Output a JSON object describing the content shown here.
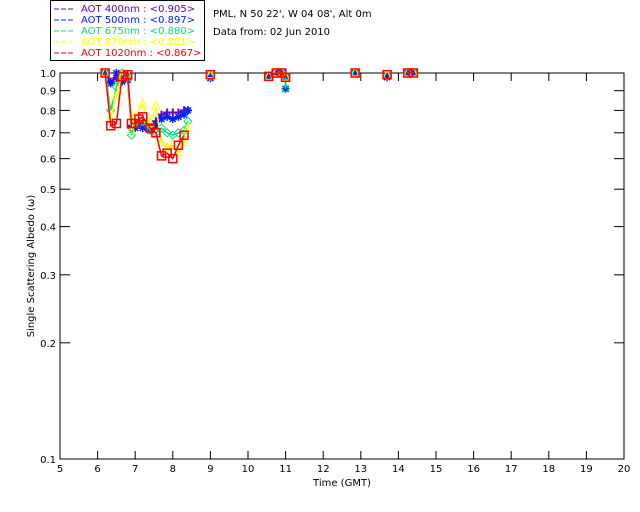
{
  "header": {
    "site_line": "PML, N 50 22', W 04 08', Alt 0m",
    "date_line": "Data from: 02 Jun 2010"
  },
  "chart_data": {
    "type": "scatter",
    "xlabel": "Time (GMT)",
    "ylabel": "Single Scattering Albedo (ω)",
    "xlim": [
      5,
      20
    ],
    "ylim": [
      0.1,
      1.0
    ],
    "yscale": "log",
    "xticks": [
      "5",
      "6",
      "7",
      "8",
      "9",
      "10",
      "11",
      "12",
      "13",
      "14",
      "15",
      "16",
      "17",
      "18",
      "19",
      "20"
    ],
    "yticks": [
      "0.1",
      "0.2",
      "0.3",
      "0.4",
      "0.5",
      "0.6",
      "0.7",
      "0.8",
      "0.9",
      "1.0"
    ],
    "grid": false,
    "legend_position": "top-left outside",
    "series": [
      {
        "name": "AOT  400nm : <0.905>",
        "color": "#6a00b0",
        "marker": "plus",
        "x": [
          6.2,
          6.35,
          6.5,
          6.65,
          6.8,
          6.9,
          7.0,
          7.2,
          7.4,
          7.55,
          7.7,
          7.85,
          8.0,
          8.15,
          8.3,
          8.4,
          9.0,
          10.55,
          10.75,
          10.9,
          11.0,
          12.85,
          13.7,
          14.25,
          14.4
        ],
        "y": [
          1.0,
          0.95,
          0.97,
          0.96,
          0.99,
          0.73,
          0.73,
          0.74,
          0.73,
          0.75,
          0.78,
          0.79,
          0.79,
          0.79,
          0.8,
          0.8,
          0.98,
          0.98,
          1.0,
          1.0,
          0.975,
          1.0,
          0.985,
          1.0,
          1.0
        ]
      },
      {
        "name": "AOT  500nm : <0.897>",
        "color": "#0020ff",
        "marker": "star",
        "x": [
          6.2,
          6.35,
          6.5,
          6.65,
          6.8,
          6.9,
          7.0,
          7.2,
          7.4,
          7.55,
          7.7,
          7.85,
          8.0,
          8.15,
          8.3,
          8.4,
          9.0,
          10.55,
          10.75,
          10.9,
          11.0,
          11.0,
          12.85,
          13.7,
          14.25,
          14.4
        ],
        "y": [
          1.0,
          0.94,
          1.0,
          0.95,
          0.96,
          0.72,
          0.72,
          0.72,
          0.71,
          0.73,
          0.76,
          0.77,
          0.76,
          0.77,
          0.78,
          0.8,
          0.97,
          0.98,
          1.0,
          1.0,
          0.975,
          0.91,
          1.0,
          0.975,
          1.0,
          1.0
        ]
      },
      {
        "name": "AOT  675nm : <0.880>",
        "color": "#00e080",
        "marker": "diamond",
        "x": [
          6.2,
          6.35,
          6.5,
          6.65,
          6.8,
          6.9,
          7.0,
          7.2,
          7.4,
          7.55,
          7.7,
          7.85,
          8.0,
          8.15,
          8.3,
          8.4,
          9.0,
          10.55,
          10.75,
          10.9,
          11.0,
          11.0,
          12.85,
          13.7,
          14.25,
          14.4
        ],
        "y": [
          1.0,
          0.8,
          0.92,
          1.0,
          0.97,
          0.69,
          0.74,
          0.75,
          0.71,
          0.7,
          0.72,
          0.7,
          0.69,
          0.7,
          0.71,
          0.75,
          0.98,
          0.98,
          1.0,
          1.0,
          0.975,
          0.91,
          1.0,
          0.985,
          1.0,
          1.0
        ]
      },
      {
        "name": "AOT  870nm : <0.881>",
        "color": "#ffff00",
        "marker": "triangle",
        "x": [
          6.2,
          6.35,
          6.5,
          6.65,
          6.8,
          6.9,
          7.0,
          7.2,
          7.4,
          7.55,
          7.7,
          7.85,
          8.0,
          8.15,
          8.3,
          8.4,
          9.0,
          10.55,
          10.75,
          10.9,
          11.0,
          12.85,
          13.7,
          14.25,
          14.4
        ],
        "y": [
          1.0,
          0.76,
          0.87,
          0.98,
          0.99,
          0.71,
          0.77,
          0.83,
          0.74,
          0.82,
          0.66,
          0.64,
          0.65,
          0.62,
          0.66,
          0.72,
          0.99,
          0.98,
          1.0,
          1.0,
          0.975,
          1.0,
          0.985,
          1.0,
          1.0
        ]
      },
      {
        "name": "AOT 1020nm : <0.867>",
        "color": "#ff0000",
        "marker": "square",
        "x": [
          6.2,
          6.35,
          6.5,
          6.65,
          6.8,
          6.9,
          7.0,
          7.1,
          7.2,
          7.4,
          7.55,
          7.7,
          7.85,
          8.0,
          8.15,
          8.3,
          9.0,
          10.55,
          10.75,
          10.9,
          11.0,
          12.85,
          13.7,
          14.25,
          14.4
        ],
        "y": [
          1.0,
          0.73,
          0.74,
          0.98,
          0.99,
          0.74,
          0.74,
          0.76,
          0.77,
          0.72,
          0.7,
          0.61,
          0.62,
          0.6,
          0.65,
          0.69,
          0.99,
          0.98,
          1.0,
          1.0,
          0.975,
          1.0,
          0.99,
          1.0,
          1.0
        ]
      }
    ]
  }
}
